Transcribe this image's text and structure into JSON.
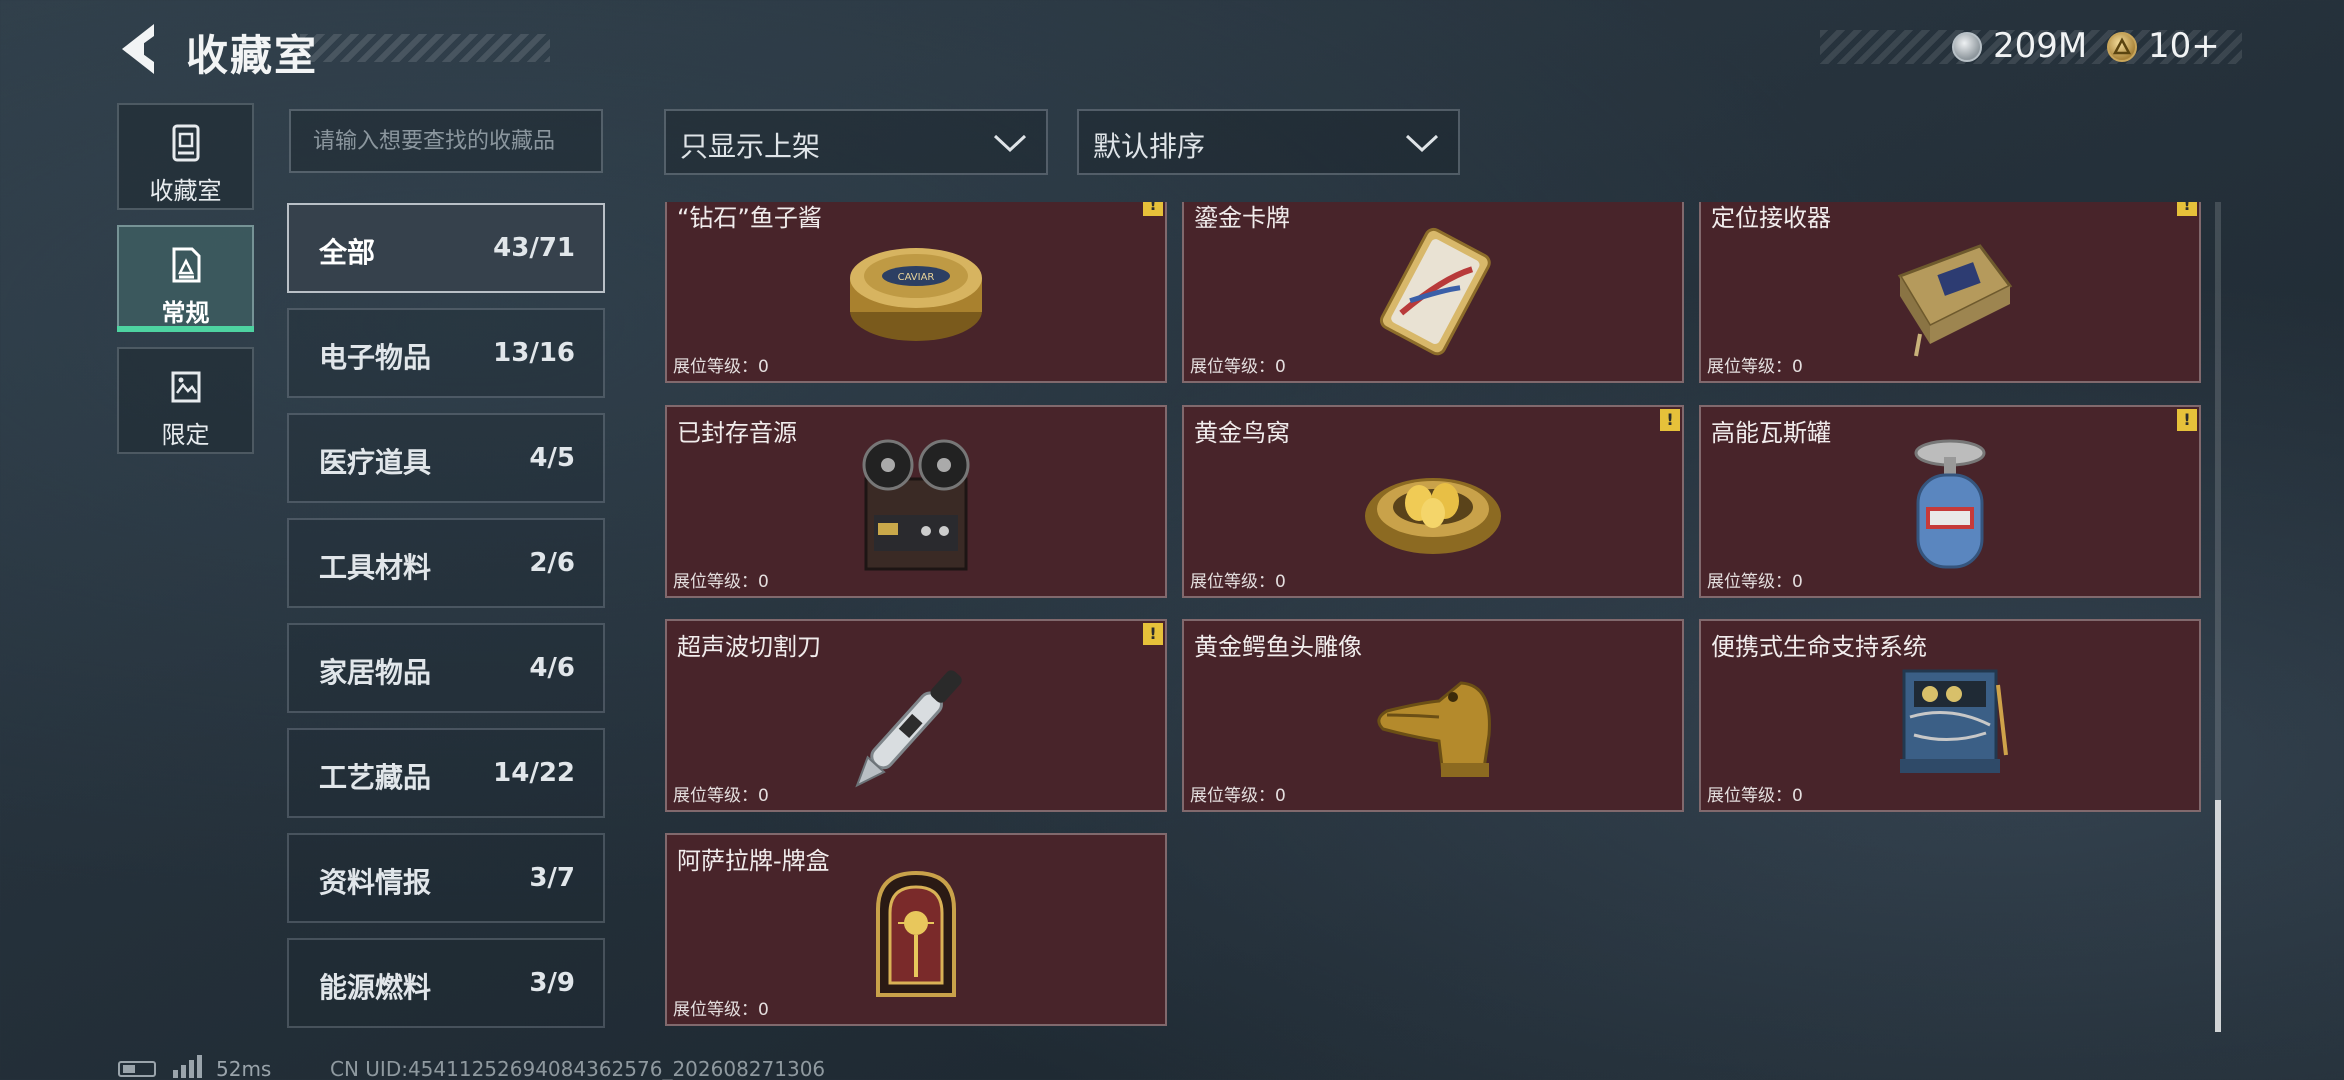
{
  "header": {
    "title": "收藏室"
  },
  "currency": [
    {
      "icon": "silver-coin-icon",
      "value": "209M",
      "color": "#c5cdd3"
    },
    {
      "icon": "gold-triangle-coin-icon",
      "value": "10+",
      "color": "#d4b25a"
    }
  ],
  "nav": [
    {
      "icon": "collection-room-icon",
      "label": "收藏室",
      "active": false
    },
    {
      "icon": "regular-items-icon",
      "label": "常规",
      "active": true
    },
    {
      "icon": "limited-items-icon",
      "label": "限定",
      "active": false
    }
  ],
  "search": {
    "placeholder": "请输入想要查找的收藏品"
  },
  "filters": {
    "display": "只显示上架",
    "sort": "默认排序"
  },
  "categories": [
    {
      "name": "全部",
      "count": "43/71",
      "active": true
    },
    {
      "name": "电子物品",
      "count": "13/16"
    },
    {
      "name": "医疗道具",
      "count": "4/5"
    },
    {
      "name": "工具材料",
      "count": "2/6"
    },
    {
      "name": "家居物品",
      "count": "4/6"
    },
    {
      "name": "工艺藏品",
      "count": "14/22"
    },
    {
      "name": "资料情报",
      "count": "3/7"
    },
    {
      "name": "能源燃料",
      "count": "3/9"
    }
  ],
  "items": [
    {
      "name": "“钻石”鱼子酱",
      "level": "展位等级：0",
      "icon": "caviar-tin-icon",
      "warning": true
    },
    {
      "name": "鎏金卡牌",
      "level": "展位等级：0",
      "icon": "gilded-card-icon",
      "warning": false
    },
    {
      "name": "定位接收器",
      "level": "展位等级：0",
      "icon": "locator-receiver-icon",
      "warning": true
    },
    {
      "name": "已封存音源",
      "level": "展位等级：0",
      "icon": "reel-recorder-icon",
      "warning": false
    },
    {
      "name": "黄金鸟窝",
      "level": "展位等级：0",
      "icon": "golden-nest-icon",
      "warning": true
    },
    {
      "name": "高能瓦斯罐",
      "level": "展位等级：0",
      "icon": "gas-canister-icon",
      "warning": true
    },
    {
      "name": "超声波切割刀",
      "level": "展位等级：0",
      "icon": "ultrasonic-knife-icon",
      "warning": true
    },
    {
      "name": "黄金鳄鱼头雕像",
      "level": "展位等级：0",
      "icon": "gold-crocodile-statue-icon",
      "warning": false
    },
    {
      "name": "便携式生命支持系统",
      "level": "展位等级：0",
      "icon": "life-support-system-icon",
      "warning": false
    },
    {
      "name": "阿萨拉牌-牌盒",
      "level": "展位等级：0",
      "icon": "card-box-icon",
      "warning": false
    }
  ],
  "warning_mark": "!",
  "footer": {
    "ping": "52ms",
    "uid": "CN UID:45411252694084362576_202608271306"
  }
}
